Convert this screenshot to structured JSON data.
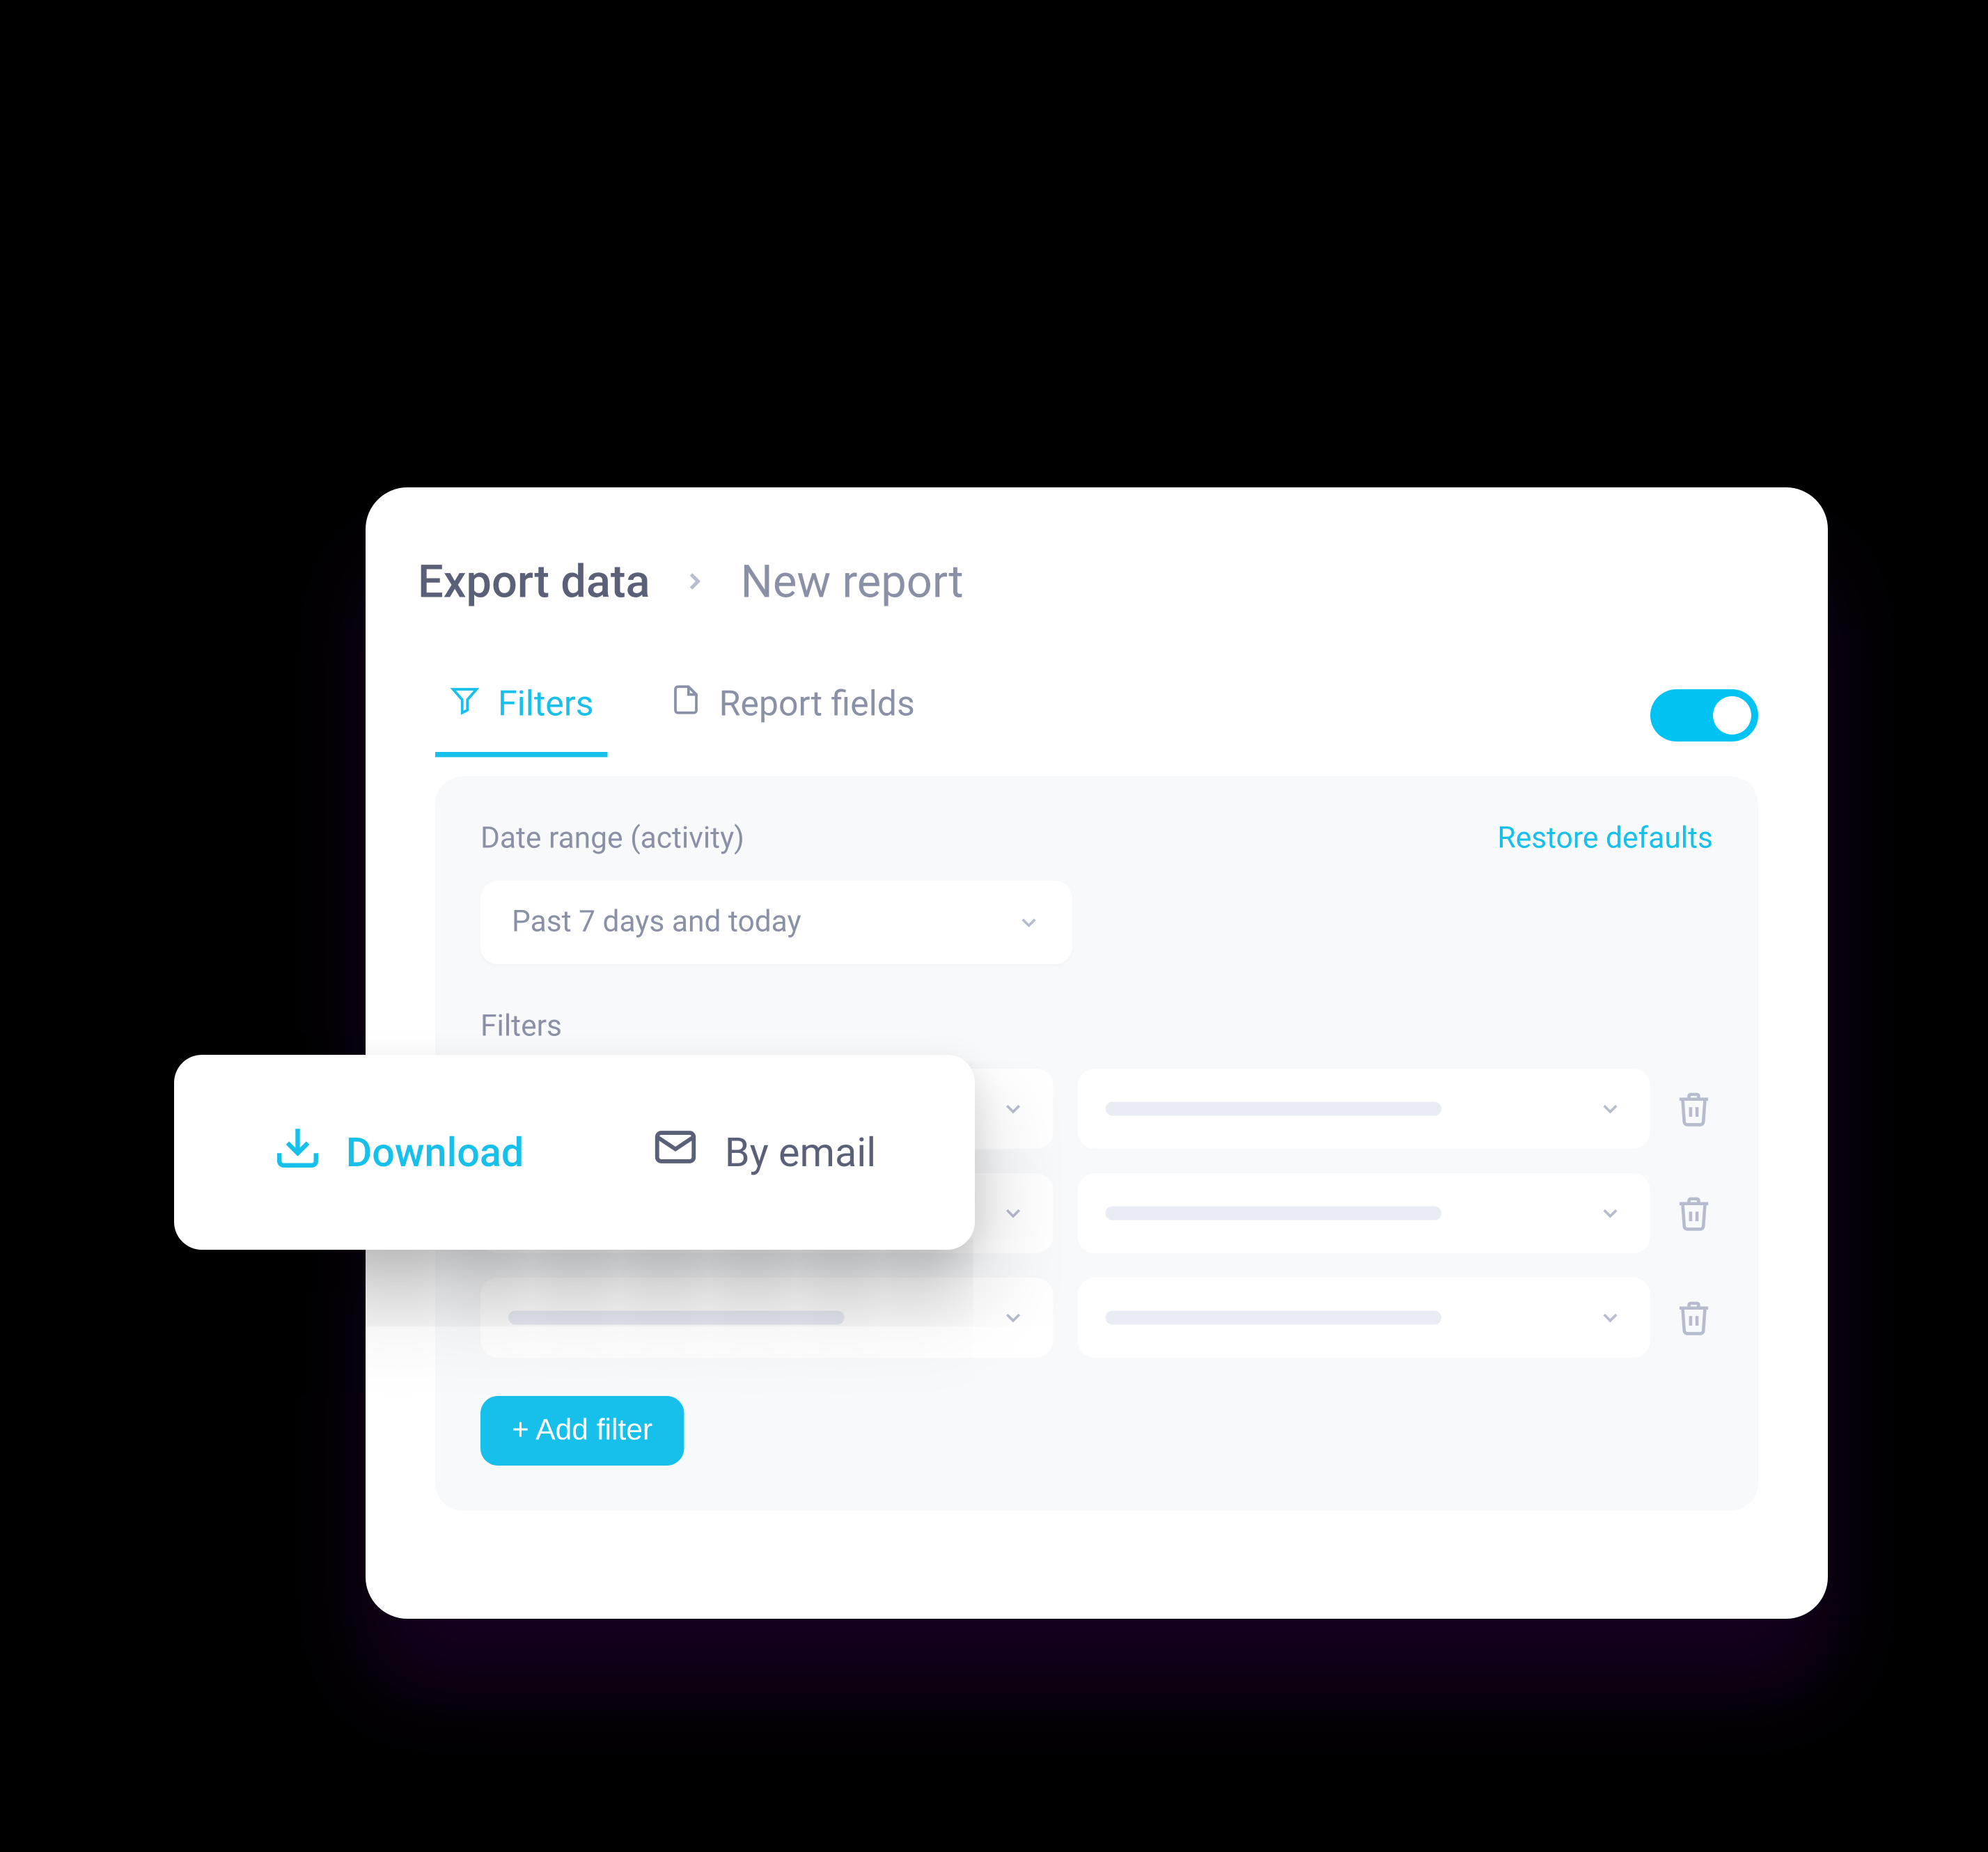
{
  "breadcrumb": {
    "root": "Export data",
    "current": "New report"
  },
  "tabs": {
    "filters": "Filters",
    "report_fields": "Report fields"
  },
  "panel": {
    "date_range_label": "Date range (activity)",
    "date_range_value": "Past 7 days and today",
    "restore": "Restore defaults",
    "filters_label": "Filters",
    "add_filter": "+ Add filter"
  },
  "filter_rows": [
    {
      "field": "",
      "value": ""
    },
    {
      "field": "",
      "value": ""
    },
    {
      "field": "",
      "value": ""
    }
  ],
  "popover": {
    "download": "Download",
    "by_email": "By email"
  },
  "toggle_on": true,
  "colors": {
    "accent": "#17c0eb",
    "muted": "#8a90a6",
    "panel_bg": "#f8f9fb"
  }
}
